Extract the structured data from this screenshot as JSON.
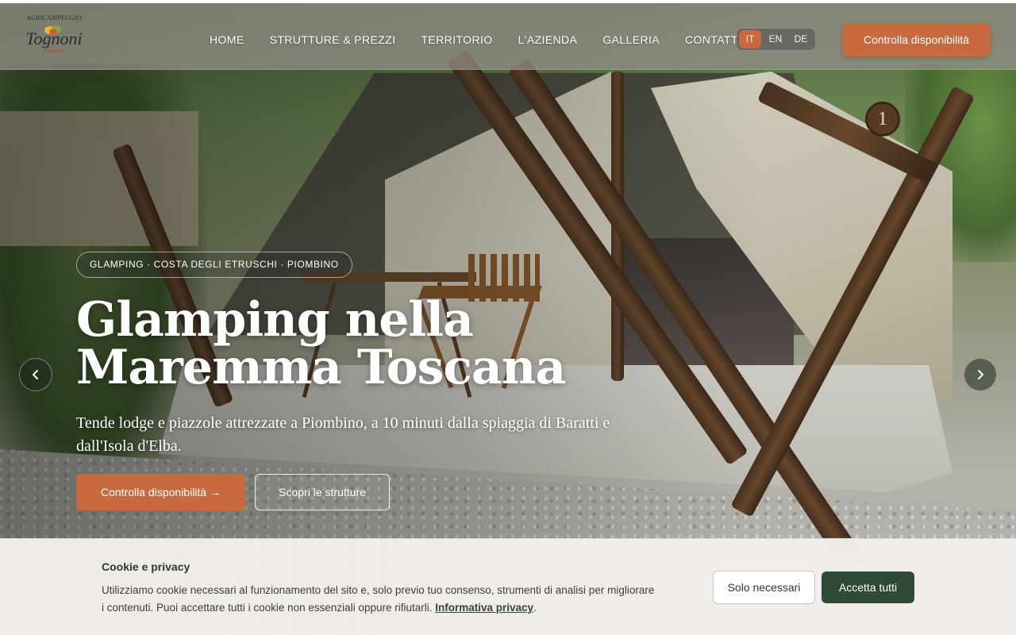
{
  "header": {
    "logo": {
      "top_text": "AGRICAMPEGGIO",
      "name": "Tognoni",
      "sub_text": "Glamping"
    },
    "nav": [
      {
        "label": "HOME"
      },
      {
        "label": "STRUTTURE & PREZZI"
      },
      {
        "label": "TERRITORIO"
      },
      {
        "label": "L'AZIENDA"
      },
      {
        "label": "GALLERIA"
      },
      {
        "label": "CONTATTI"
      }
    ],
    "languages": {
      "items": [
        "IT",
        "EN",
        "DE"
      ],
      "active": "IT"
    },
    "cta_label": "Controlla disponibilità"
  },
  "hero": {
    "tent_number": "1",
    "pill": "GLAMPING · COSTA DEGLI ETRUSCHI · PIOMBINO",
    "title_line1": "Glamping nella",
    "title_line2": "Maremma Toscana",
    "subtitle": "Tende lodge e piazzole attrezzate a Piombino, a 10 minuti dalla spiaggia di Baratti e dall'Isola d'Elba.",
    "primary_cta": "Controlla disponibilità →",
    "secondary_cta": "Scopri le strutture",
    "prev_icon": "chevron-left-icon",
    "next_icon": "chevron-right-icon"
  },
  "cookie": {
    "title": "Cookie e privacy",
    "text": "Utilizziamo cookie necessari al funzionamento del sito e, solo previo tuo consenso, strumenti di analisi per migliorare i contenuti. Puoi accettare tutti i cookie non essenziali oppure rifiutarli.",
    "link_label": "Informativa privacy",
    "link_suffix": ".",
    "necessary_label": "Solo necessari",
    "accept_label": "Accetta tutti"
  },
  "colors": {
    "accent": "#c9693f",
    "dark_green": "#2f4a35",
    "banner_bg": "#f3f0ea"
  }
}
